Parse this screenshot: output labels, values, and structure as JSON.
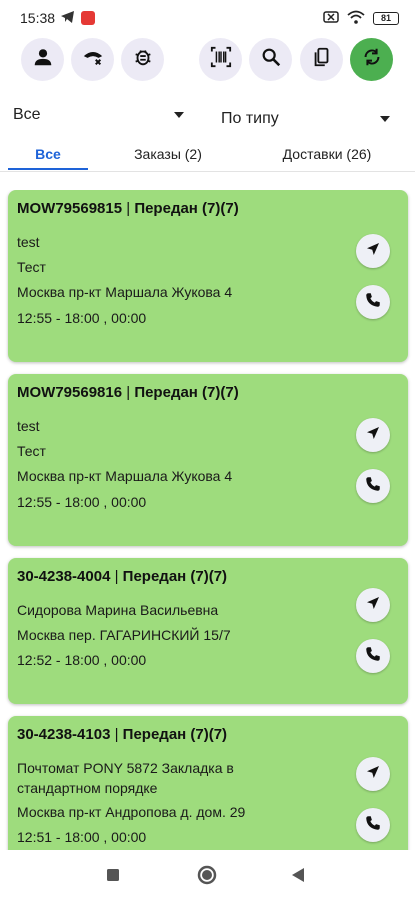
{
  "status_bar": {
    "time": "15:38",
    "battery": "81"
  },
  "toolbar": {
    "buttons": [
      "profile-icon",
      "hide-icon",
      "bug-icon",
      "barcode-icon",
      "search-icon",
      "copy-icon",
      "sync-icon"
    ],
    "accent_color": "#4caf50"
  },
  "filters": {
    "left_select": "Все",
    "right_select": "По типу"
  },
  "tabs": [
    {
      "label": "Все",
      "active": true
    },
    {
      "label": "Заказы (2)",
      "active": false
    },
    {
      "label": "Доставки (26)",
      "active": false
    }
  ],
  "cards": [
    {
      "code": "MOW79569815",
      "separator": "|",
      "status": "Передан (7)(7)",
      "lines": [
        "test",
        "Тест",
        "Москва пр-кт Маршала Жукова 4",
        "12:55 - 18:00 , 00:00"
      ]
    },
    {
      "code": "MOW79569816",
      "separator": "|",
      "status": "Передан (7)(7)",
      "lines": [
        "test",
        "Тест",
        "Москва пр-кт Маршала Жукова 4",
        "12:55 - 18:00 , 00:00"
      ]
    },
    {
      "code": "30-4238-4004",
      "separator": "|",
      "status": "Передан (7)(7)",
      "lines": [
        "Сидорова Марина Васильевна",
        "Москва пер. ГАГАРИНСКИЙ 15/7",
        "12:52 - 18:00 , 00:00"
      ]
    },
    {
      "code": "30-4238-4103",
      "separator": "|",
      "status": "Передан (7)(7)",
      "lines": [
        "Почтомат PONY 5872 Закладка в стандартном порядке",
        "Москва пр-кт  Андропова д. дом. 29",
        "12:51 - 18:00 , 00:00"
      ]
    }
  ],
  "card_color": "#9edc7d",
  "tab_active_color": "#1e63d8"
}
